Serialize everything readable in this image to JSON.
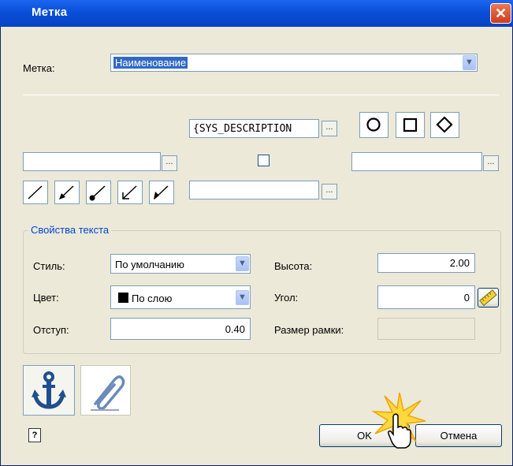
{
  "window": {
    "title": "Метка",
    "close_glyph": "✕"
  },
  "label_row": {
    "label": "Метка:",
    "value": "Наименование"
  },
  "top_field": {
    "value": "{SYS_DESCRIPTION",
    "button": "..."
  },
  "browse_button": "...",
  "text_props": {
    "group_title": "Свойства текста",
    "style_label": "Стиль:",
    "style_value": "По умолчанию",
    "color_label": "Цвет:",
    "color_value": "По слою",
    "offset_label": "Отступ:",
    "offset_value": "0.40",
    "height_label": "Высота:",
    "height_value": "2.00",
    "angle_label": "Угол:",
    "angle_value": "0",
    "frame_label": "Размер рамки:",
    "frame_value": ""
  },
  "buttons": {
    "ok": "OK",
    "cancel": "Отмена"
  },
  "colors": {
    "title_bar": "#0a4fd8",
    "dialog_bg": "#ece9d8",
    "group_title": "#0046d5",
    "selection": "#316ac5",
    "anchor": "#1f4f8f"
  }
}
